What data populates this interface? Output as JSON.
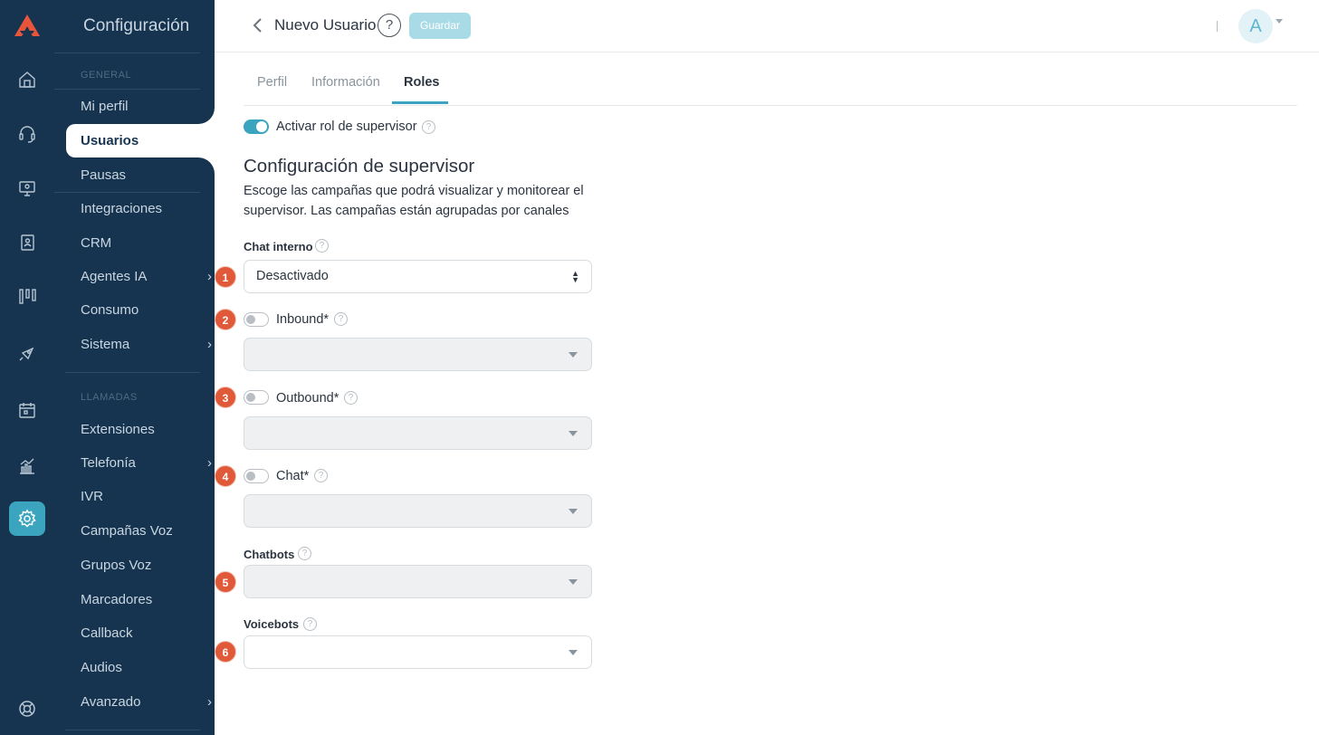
{
  "sidebar": {
    "title": "Configuración",
    "sections": {
      "general": "GENERAL",
      "llamadas": "LLAMADAS"
    },
    "items": [
      {
        "label": "Mi perfil"
      },
      {
        "label": "Usuarios"
      },
      {
        "label": "Pausas"
      },
      {
        "label": "Integraciones"
      },
      {
        "label": "CRM"
      },
      {
        "label": "Agentes IA"
      },
      {
        "label": "Consumo"
      },
      {
        "label": "Sistema"
      },
      {
        "label": "Extensiones"
      },
      {
        "label": "Telefonía"
      },
      {
        "label": "IVR"
      },
      {
        "label": "Campañas Voz"
      },
      {
        "label": "Grupos Voz"
      },
      {
        "label": "Marcadores"
      },
      {
        "label": "Callback"
      },
      {
        "label": "Audios"
      },
      {
        "label": "Avanzado"
      }
    ],
    "chevron": "›"
  },
  "rail": {
    "icons": [
      "logo-icon",
      "home-icon",
      "headset-icon",
      "monitor-icon",
      "contacts-book-icon",
      "kanban-icon",
      "rocket-icon",
      "calendar-icon",
      "analytics-icon",
      "gear-icon",
      "support-icon"
    ],
    "accent": "#3ba5bf"
  },
  "header": {
    "title": "Nuevo Usuario",
    "help": "?",
    "save_label": "Guardar",
    "avatar_initial": "A"
  },
  "tabs": [
    {
      "label": "Perfil"
    },
    {
      "label": "Información"
    },
    {
      "label": "Roles",
      "active": true
    }
  ],
  "roles": {
    "supervisor_toggle_label": "Activar rol de supervisor",
    "supervisor_enabled": true,
    "heading": "Configuración de supervisor",
    "description": "Escoge las campañas que podrá visualizar y monitorear el supervisor. Las campañas están agrupadas por canales",
    "help": "?",
    "fields": {
      "chat_interno": {
        "label": "Chat interno",
        "value": "Desactivado",
        "badge": "1"
      },
      "inbound": {
        "label": "Inbound*",
        "enabled": false,
        "value": "",
        "badge": "2"
      },
      "outbound": {
        "label": "Outbound*",
        "enabled": false,
        "value": "",
        "badge": "3"
      },
      "chat": {
        "label": "Chat*",
        "enabled": false,
        "value": "",
        "badge": "4"
      },
      "chatbots": {
        "label": "Chatbots",
        "value": "",
        "badge": "5"
      },
      "voicebots": {
        "label": "Voicebots",
        "value": "",
        "badge": "6"
      }
    }
  },
  "colors": {
    "sidebar_bg": "#16344f",
    "accent": "#3ba5bf",
    "badge": "#e05a3a",
    "save_disabled": "#a9dbe6"
  }
}
